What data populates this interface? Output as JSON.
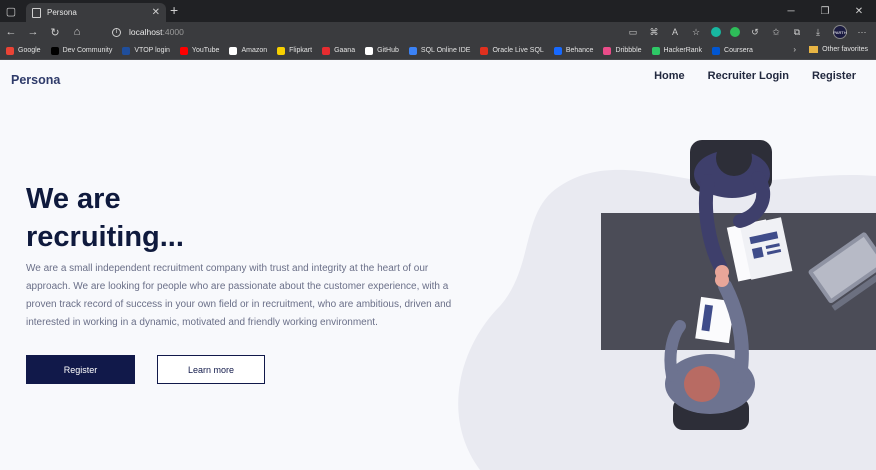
{
  "browser": {
    "tab_title": "Persona",
    "url_host": "localhost",
    "url_port": ":4000",
    "avatar_text": "PARTH"
  },
  "bookmarks": [
    {
      "label": "Google",
      "color": "#ea4335"
    },
    {
      "label": "Dev Community",
      "color": "#000000"
    },
    {
      "label": "VTOP login",
      "color": "#1f4e9c"
    },
    {
      "label": "YouTube",
      "color": "#ff0000"
    },
    {
      "label": "Amazon",
      "color": "#ffffff"
    },
    {
      "label": "Flipkart",
      "color": "#f7d000"
    },
    {
      "label": "Gaana",
      "color": "#e72c30"
    },
    {
      "label": "GitHub",
      "color": "#ffffff"
    },
    {
      "label": "SQL Online IDE",
      "color": "#3b82f6"
    },
    {
      "label": "Oracle Live SQL",
      "color": "#e0301e"
    },
    {
      "label": "Behance",
      "color": "#1769ff"
    },
    {
      "label": "Dribbble",
      "color": "#ea4c89"
    },
    {
      "label": "HackerRank",
      "color": "#2ec866"
    },
    {
      "label": "Coursera",
      "color": "#0056d2"
    }
  ],
  "other_favorites": "Other favorites",
  "site": {
    "brand": "Persona",
    "nav": [
      "Home",
      "Recruiter Login",
      "Register"
    ]
  },
  "hero": {
    "title": "We are recruiting...",
    "text": "We are a small independent recruitment company with trust and integrity at the heart of our approach. We are looking for people who are passionate about the customer experience, with a proven track record of success in your own field or in recruitment, who are ambitious, driven and interested in working in a dynamic, motivated and friendly working environment.",
    "primary_button": "Register",
    "secondary_button": "Learn more"
  },
  "colors": {
    "brand": "#2f3b6a",
    "primary": "#11194a",
    "accent": "#3f4c8a"
  }
}
